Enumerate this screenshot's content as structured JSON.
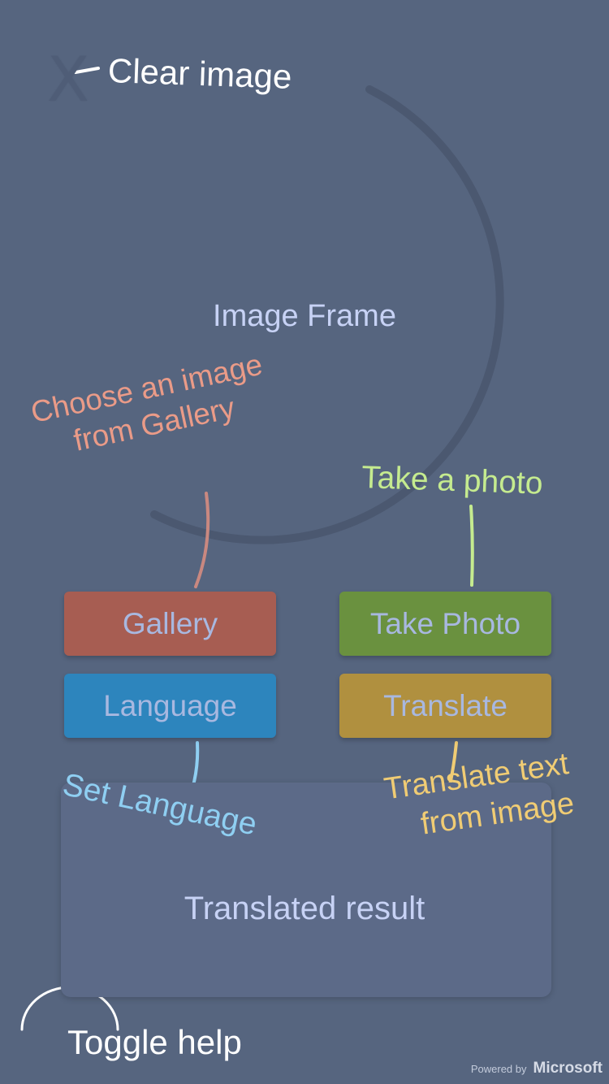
{
  "clear_image": {
    "glyph": "X",
    "annotation": "Clear image"
  },
  "image_frame": {
    "label": "Image Frame"
  },
  "hints": {
    "gallery_line1": "Choose an image",
    "gallery_line2": "from Gallery",
    "take_photo": "Take a photo",
    "language": "Set Language",
    "translate_line1": "Translate text",
    "translate_line2": "from image",
    "toggle_help": "Toggle help"
  },
  "buttons": {
    "gallery": "Gallery",
    "take_photo": "Take Photo",
    "language": "Language",
    "translate": "Translate"
  },
  "result": {
    "label": "Translated result"
  },
  "footer": {
    "powered_by": "Powered by",
    "brand": "Microsoft"
  },
  "colors": {
    "background": "#56657f",
    "gallery_button": "#a75d52",
    "take_photo_button": "#6a913f",
    "language_button": "#2d85bd",
    "translate_button": "#b0903f"
  }
}
